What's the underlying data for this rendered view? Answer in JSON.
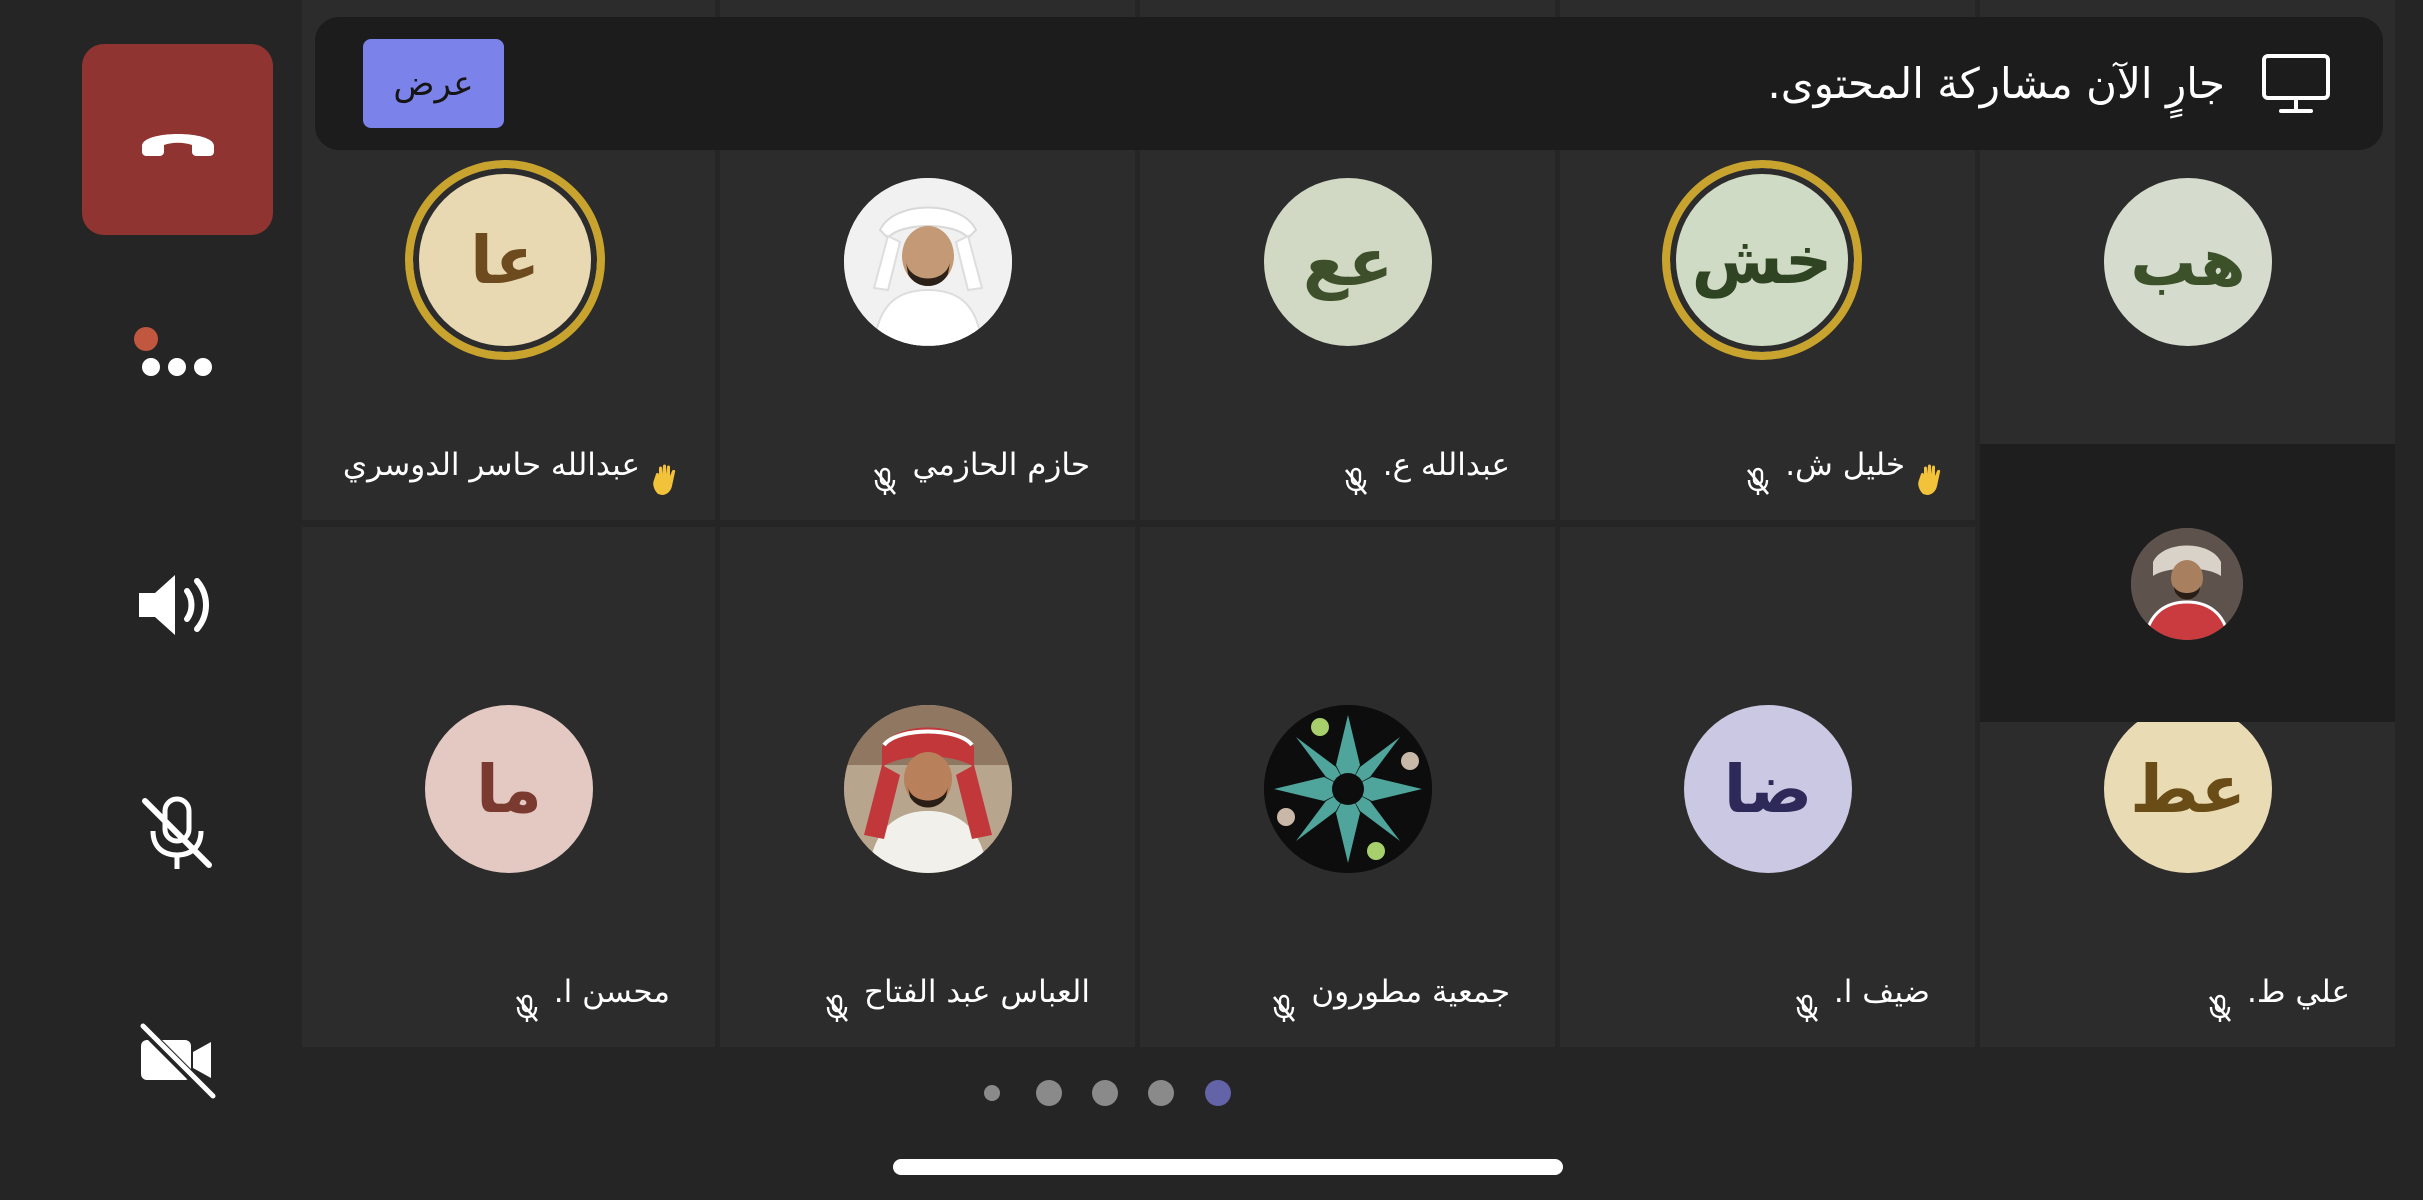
{
  "controls": {
    "hangup": {
      "icon": "phone-hangup-icon",
      "color": "#8f3431"
    },
    "more": {
      "icon": "more-icon",
      "badge_color": "#c1573f"
    },
    "speaker": {
      "icon": "speaker-icon"
    },
    "mic": {
      "icon": "mic-off-icon"
    },
    "camera": {
      "icon": "camera-off-icon"
    }
  },
  "banner": {
    "text": "جارٍ الآن مشاركة المحتوى.",
    "button_label": "عرض",
    "button_color": "#7b83eb",
    "icon": "monitor-icon"
  },
  "tiles": [
    {
      "name": "",
      "initials": "هب",
      "avatar_bg": "#d6dccd",
      "initials_color": "#3c5029",
      "muted": false,
      "hand_raised": false,
      "ring": false
    },
    {
      "name": "خليل ش.",
      "initials": "خش",
      "avatar_bg": "#cfdbc4",
      "initials_color": "#2f4422",
      "muted": true,
      "hand_raised": true,
      "ring": true
    },
    {
      "name": "عبدالله ع.",
      "initials": "عع",
      "avatar_bg": "#d1d8c3",
      "initials_color": "#3e4f2c",
      "muted": true,
      "hand_raised": false,
      "ring": false
    },
    {
      "name": "حازم  الحازمي",
      "initials": "",
      "photo": true,
      "muted": true,
      "hand_raised": false,
      "ring": false
    },
    {
      "name": "عبدالله حاسر الدوسري",
      "initials": "عا",
      "avatar_bg": "#e8d9b2",
      "initials_color": "#6e4b1e",
      "muted": false,
      "hand_raised": true,
      "ring": true
    },
    {
      "name": "علي ط.",
      "initials": "عط",
      "avatar_bg": "#e9dcb4",
      "initials_color": "#6a4c17",
      "muted": true,
      "hand_raised": false,
      "ring": false
    },
    {
      "name": "ضيف ا.",
      "initials": "ضا",
      "avatar_bg": "#cbc8e3",
      "initials_color": "#2d2a59",
      "muted": true,
      "hand_raised": false,
      "ring": false
    },
    {
      "name": "جمعية  مطورون",
      "initials": "",
      "logo": true,
      "muted": true,
      "hand_raised": false,
      "ring": false
    },
    {
      "name": "العباس عبد الفتاح",
      "initials": "",
      "photo": true,
      "muted": true,
      "hand_raised": false,
      "ring": false
    },
    {
      "name": "محسن ا.",
      "initials": "ما",
      "avatar_bg": "#e3c9c2",
      "initials_color": "#7a3a2f",
      "muted": true,
      "hand_raised": false,
      "ring": false
    }
  ],
  "self_view": {
    "icon": "self-view-avatar"
  },
  "pagination": {
    "pages": 5,
    "current": 5,
    "active_color": "#6264a7"
  }
}
